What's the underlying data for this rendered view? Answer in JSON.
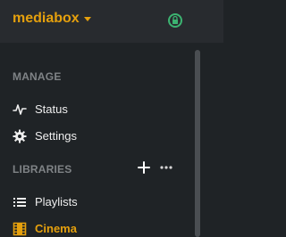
{
  "header": {
    "server_name": "mediabox",
    "server_icon": "lock-icon",
    "accent": "#e5a00d",
    "secure_color": "#3cb371"
  },
  "sections": {
    "manage": {
      "label": "MANAGE",
      "items": [
        {
          "label": "Status",
          "icon": "activity-icon"
        },
        {
          "label": "Settings",
          "icon": "gear-icon"
        }
      ]
    },
    "libraries": {
      "label": "LIBRARIES",
      "add_icon": "plus-icon",
      "more_icon": "ellipsis-icon",
      "items": [
        {
          "label": "Playlists",
          "icon": "list-icon"
        },
        {
          "label": "Cinema",
          "icon": "film-icon",
          "active": true
        }
      ]
    }
  }
}
